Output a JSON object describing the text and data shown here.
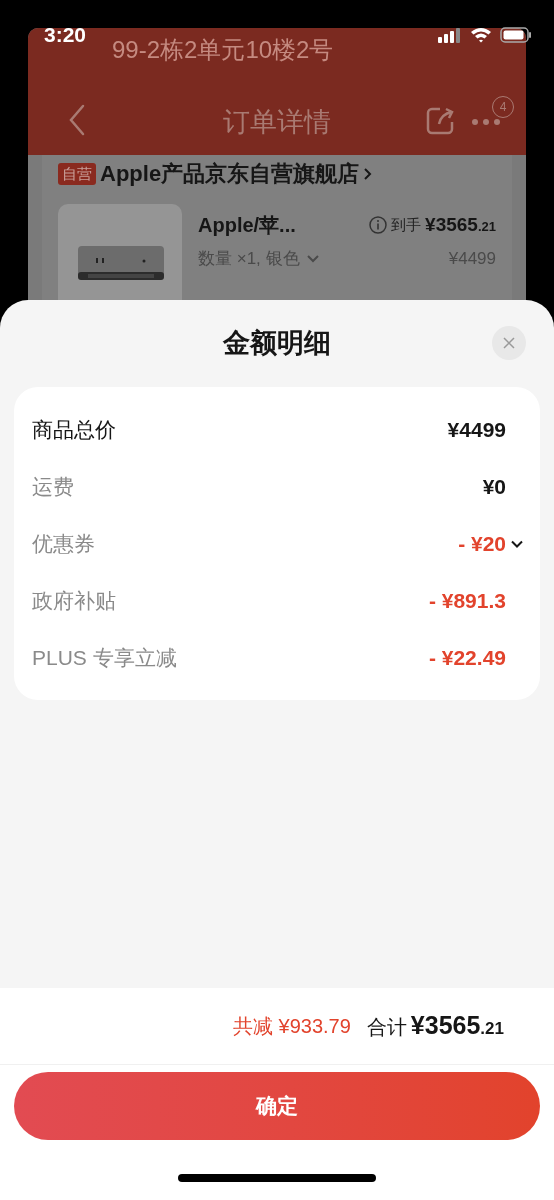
{
  "status_bar": {
    "time": "3:20"
  },
  "background_page": {
    "address": "99-2栋2单元10楼2号",
    "nav_title": "订单详情",
    "more_badge": "4",
    "store_badge": "自营",
    "store_name": "Apple产品京东自营旗舰店",
    "product": {
      "kind": "picture",
      "title": "Apple/苹...",
      "final_label": "到手",
      "final_price_integer": "¥3565",
      "final_price_decimal": ".21",
      "spec": "数量 ×1, 银色",
      "price": "¥4499"
    }
  },
  "sheet": {
    "title": "金额明细",
    "rows": [
      {
        "label": "商品总价",
        "value": "¥4499",
        "kind": "total",
        "expandable": false
      },
      {
        "label": "运费",
        "value": "¥0",
        "kind": "fee",
        "expandable": false
      },
      {
        "label": "优惠券",
        "value": "- ¥20",
        "kind": "discount",
        "expandable": true
      },
      {
        "label": "政府补贴",
        "value": "- ¥891.3",
        "kind": "discount",
        "expandable": false
      },
      {
        "label": "PLUS 专享立减",
        "value": "- ¥22.49",
        "kind": "discount",
        "expandable": false
      }
    ],
    "summary": {
      "saved": "共减 ¥933.79",
      "total_label": "合计",
      "total_integer": "¥3565",
      "total_decimal": ".21"
    },
    "confirm_button": "确定"
  }
}
